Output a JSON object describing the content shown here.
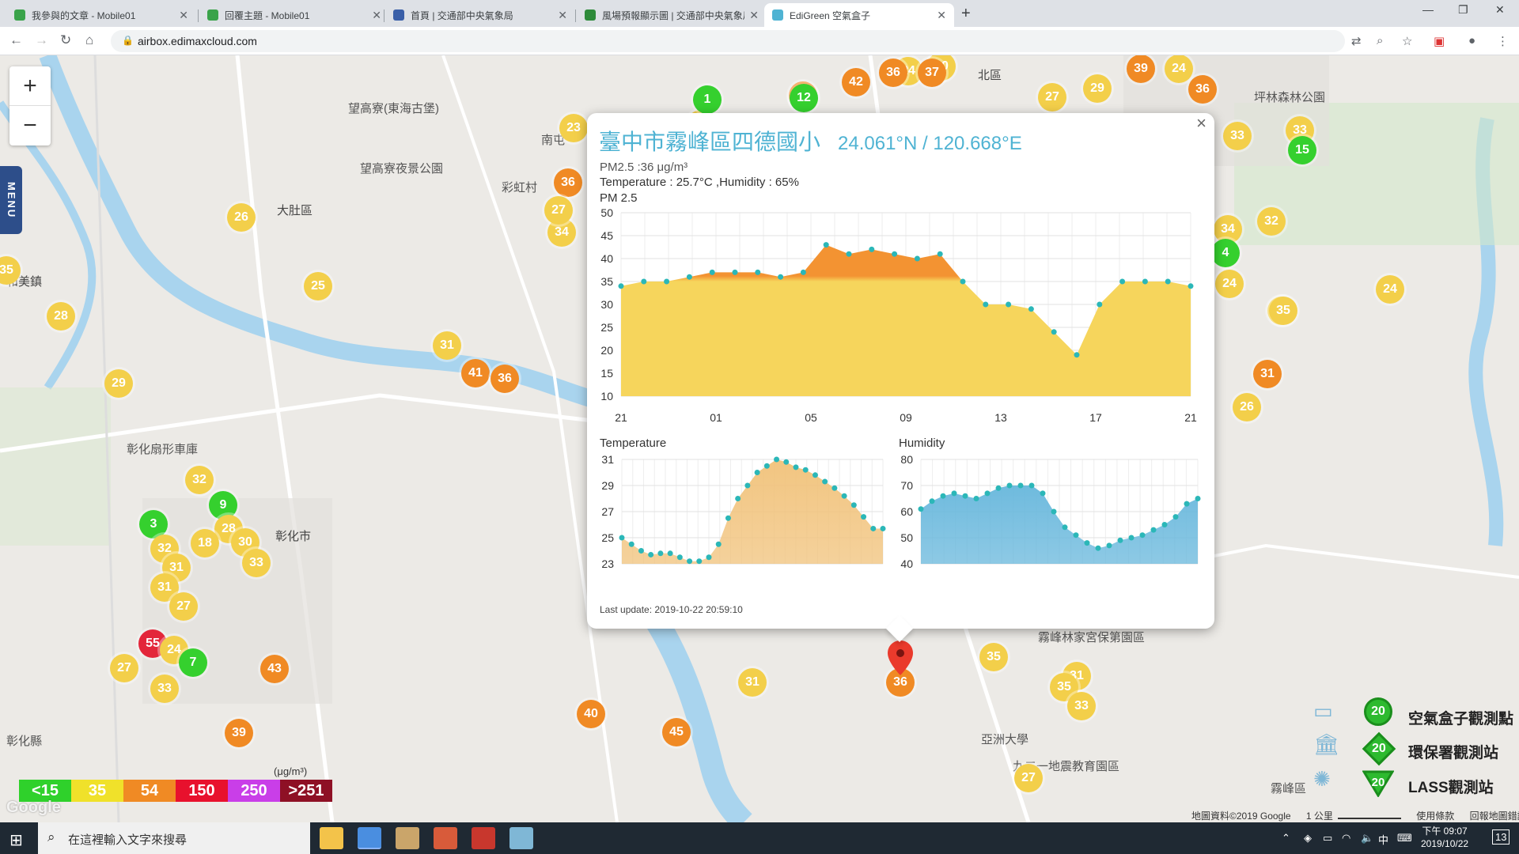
{
  "browser": {
    "tabs": [
      {
        "label": "我參與的文章 - Mobile01",
        "fav": "#3aa34a"
      },
      {
        "label": "回覆主題 - Mobile01",
        "fav": "#3aa34a"
      },
      {
        "label": "首頁 | 交通部中央氣象局",
        "fav": "#3a5fa8"
      },
      {
        "label": "風場預報顯示圖 | 交通部中央氣象局",
        "fav": "#2e8b3a"
      },
      {
        "label": "EdiGreen 空氣盒子",
        "fav": "#4fb3d3"
      }
    ],
    "url": "airbox.edimaxcloud.com"
  },
  "map": {
    "zoom_in": "+",
    "zoom_out": "−",
    "menu": "MENU",
    "labels": [
      {
        "text": "望高寮(東海古堡)"
      },
      {
        "text": "望高寮夜景公園"
      },
      {
        "text": "大肚區"
      },
      {
        "text": "和美鎮"
      },
      {
        "text": "彰化扇形車庫"
      },
      {
        "text": "彰化市"
      },
      {
        "text": "彰化縣"
      },
      {
        "text": "北區"
      },
      {
        "text": "坪林森林公園"
      },
      {
        "text": "霧峰林家宮保第園區"
      },
      {
        "text": "亞洲大學"
      },
      {
        "text": "九二一地震教育園區"
      },
      {
        "text": "霧峰區"
      },
      {
        "text": "彩虹村"
      },
      {
        "text": "南屯"
      }
    ]
  },
  "popup": {
    "title": "臺中市霧峰區四德國小",
    "coords": "24.061°N / 120.668°E",
    "pm_line": "PM2.5 :36 μg/m³",
    "temp_line": "Temperature : 25.7°C ,Humidity : 65%",
    "chart_title": "PM 2.5",
    "temp_title": "Temperature",
    "hum_title": "Humidity",
    "last_update": "Last update: 2019-10-22 20:59:10",
    "close": "×"
  },
  "chart_data": [
    {
      "type": "area",
      "title": "PM 2.5",
      "x_ticks": [
        "21",
        "01",
        "05",
        "09",
        "13",
        "17",
        "21"
      ],
      "ylim": [
        10,
        50
      ],
      "y_ticks": [
        10,
        15,
        20,
        25,
        30,
        35,
        40,
        45,
        50
      ],
      "values": [
        34,
        35,
        35,
        36,
        37,
        37,
        37,
        36,
        37,
        43,
        41,
        42,
        41,
        40,
        41,
        35,
        30,
        30,
        29,
        24,
        19,
        30,
        35,
        35,
        35,
        34
      ],
      "threshold": 35,
      "colors": {
        "above": "#f39332",
        "below": "#f6d55c",
        "point": "#2bb7b8"
      }
    },
    {
      "type": "area",
      "title": "Temperature",
      "ylim": [
        23,
        31
      ],
      "y_ticks": [
        23,
        25,
        27,
        29,
        31
      ],
      "values": [
        25.0,
        24.5,
        24.0,
        23.7,
        23.8,
        23.8,
        23.5,
        23.2,
        23.2,
        23.5,
        24.5,
        26.5,
        28.0,
        29.0,
        30.0,
        30.5,
        31.0,
        30.8,
        30.4,
        30.2,
        29.8,
        29.3,
        28.8,
        28.2,
        27.5,
        26.6,
        25.7,
        25.7
      ],
      "color": "#f1c27a"
    },
    {
      "type": "area",
      "title": "Humidity",
      "ylim": [
        40,
        80
      ],
      "y_ticks": [
        40,
        50,
        60,
        70,
        80
      ],
      "values": [
        61,
        64,
        66,
        67,
        66,
        65,
        67,
        69,
        70,
        70,
        70,
        67,
        60,
        54,
        51,
        48,
        46,
        47,
        49,
        50,
        51,
        53,
        55,
        58,
        63,
        65
      ],
      "color": "#67b7dc"
    }
  ],
  "markers": [
    {
      "v": "26",
      "c": "y"
    },
    {
      "v": "28",
      "c": "y"
    },
    {
      "v": "35",
      "c": "y"
    },
    {
      "v": "25",
      "c": "y"
    },
    {
      "v": "29",
      "c": "y"
    },
    {
      "v": "31",
      "c": "y"
    },
    {
      "v": "41",
      "c": "o"
    },
    {
      "v": "36",
      "c": "o"
    },
    {
      "v": "32",
      "c": "y"
    },
    {
      "v": "9",
      "c": "g"
    },
    {
      "v": "3",
      "c": "g"
    },
    {
      "v": "28",
      "c": "y"
    },
    {
      "v": "18",
      "c": "y"
    },
    {
      "v": "32",
      "c": "y"
    },
    {
      "v": "30",
      "c": "y"
    },
    {
      "v": "31",
      "c": "y"
    },
    {
      "v": "33",
      "c": "y"
    },
    {
      "v": "31",
      "c": "y"
    },
    {
      "v": "27",
      "c": "y"
    },
    {
      "v": "55",
      "c": "r"
    },
    {
      "v": "24",
      "c": "y"
    },
    {
      "v": "7",
      "c": "g"
    },
    {
      "v": "27",
      "c": "y"
    },
    {
      "v": "33",
      "c": "y"
    },
    {
      "v": "43",
      "c": "o"
    },
    {
      "v": "39",
      "c": "o"
    },
    {
      "v": "40",
      "c": "o"
    },
    {
      "v": "45",
      "c": "o"
    },
    {
      "v": "31",
      "c": "y"
    },
    {
      "v": "36",
      "c": "o"
    },
    {
      "v": "35",
      "c": "y"
    },
    {
      "v": "31",
      "c": "y"
    },
    {
      "v": "35",
      "c": "y"
    },
    {
      "v": "33",
      "c": "y"
    },
    {
      "v": "27",
      "c": "y"
    },
    {
      "v": "36",
      "c": "o"
    },
    {
      "v": "34",
      "c": "y"
    },
    {
      "v": "27",
      "c": "y"
    },
    {
      "v": "23",
      "c": "y"
    },
    {
      "v": "35",
      "c": "y"
    },
    {
      "v": "37",
      "c": "o"
    },
    {
      "v": "36",
      "c": "o"
    },
    {
      "v": "12",
      "c": "g"
    },
    {
      "v": "42",
      "c": "o"
    },
    {
      "v": "24",
      "c": "y"
    },
    {
      "v": "20",
      "c": "y"
    },
    {
      "v": "36",
      "c": "o"
    },
    {
      "v": "37",
      "c": "o"
    },
    {
      "v": "27",
      "c": "y"
    },
    {
      "v": "29",
      "c": "y"
    },
    {
      "v": "39",
      "c": "o"
    },
    {
      "v": "24",
      "c": "y"
    },
    {
      "v": "36",
      "c": "o"
    },
    {
      "v": "1",
      "c": "g"
    },
    {
      "v": "33",
      "c": "y"
    },
    {
      "v": "33",
      "c": "y"
    },
    {
      "v": "15",
      "c": "g"
    },
    {
      "v": "34",
      "c": "y"
    },
    {
      "v": "32",
      "c": "y"
    },
    {
      "v": "4",
      "c": "g"
    },
    {
      "v": "24",
      "c": "y"
    },
    {
      "v": "35",
      "c": "y"
    },
    {
      "v": "24",
      "c": "y"
    },
    {
      "v": "31",
      "c": "o"
    },
    {
      "v": "26",
      "c": "y"
    },
    {
      "v": "35",
      "c": "y"
    }
  ],
  "aqi_legend": [
    {
      "label": "<15",
      "color": "#2fd12b"
    },
    {
      "label": "35",
      "color": "#f0e12a"
    },
    {
      "label": "54",
      "color": "#f08a24"
    },
    {
      "label": "150",
      "color": "#e8112d"
    },
    {
      "label": "250",
      "color": "#c93ee8"
    },
    {
      "label": ">251",
      "color": "#8e1025"
    }
  ],
  "aqi_unit": "(μg/m³)",
  "station_legend": [
    {
      "label": "空氣盒子觀測點",
      "value": "20"
    },
    {
      "label": "環保署觀測站",
      "value": "20"
    },
    {
      "label": "LASS觀測站",
      "value": "20"
    }
  ],
  "map_footer": {
    "data": "地圖資料©2019 Google",
    "scale": "1 公里",
    "terms": "使用條款",
    "report": "回報地圖錯誤"
  },
  "google": "Google",
  "taskbar": {
    "search_placeholder": "在這裡輸入文字來搜尋",
    "time": "下午 09:07",
    "date": "2019/10/22",
    "ime": "中",
    "notif": "13"
  }
}
